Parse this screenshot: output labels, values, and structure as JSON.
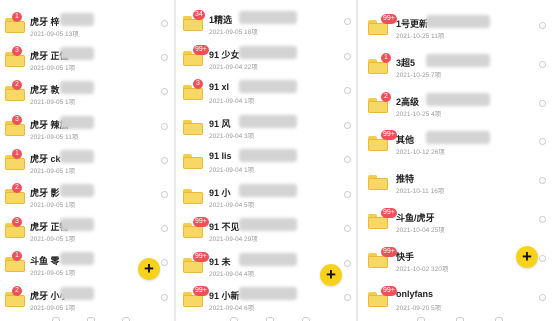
{
  "panel1": {
    "items": [
      {
        "badge": "1",
        "name": "虎牙 梓",
        "meta": "2021-09-05 13项",
        "blur": true
      },
      {
        "badge": "3",
        "name": "虎牙 正懂",
        "meta": "2021-09-05 1项",
        "blur": true
      },
      {
        "badge": "2",
        "name": "虎牙 敦",
        "meta": "2021-09-05 1项",
        "blur": true
      },
      {
        "badge": "3",
        "name": "虎牙 辣加",
        "meta": "2021-09-05 11项",
        "blur": true
      },
      {
        "badge": "1",
        "name": "虎牙 ck",
        "meta": "2021-09-05 1项",
        "blur": true
      },
      {
        "badge": "2",
        "name": "虎牙 影",
        "meta": "2021-09-05 1项",
        "blur": true
      },
      {
        "badge": "3",
        "name": "虎牙 正物",
        "meta": "2021-09-05 1项",
        "blur": true
      },
      {
        "badge": "1",
        "name": "斗鱼 零",
        "meta": "2021-09-05 1项",
        "blur": true
      },
      {
        "badge": "2",
        "name": "虎牙 小小",
        "meta": "2021-09-05 1项",
        "blur": true
      }
    ],
    "fab": "+"
  },
  "panel2": {
    "items": [
      {
        "badge": "34",
        "name": "1精选",
        "meta": "2021-09-05 18项",
        "blur": true
      },
      {
        "badge": "99+",
        "name": "91 少女",
        "meta": "2021-09-04 22项",
        "blur": true
      },
      {
        "badge": "3",
        "name": "91 xl",
        "meta": "2021-09-04 1项",
        "blur": true
      },
      {
        "badge": "",
        "name": "91 风",
        "meta": "2021-09-04 3项",
        "blur": true
      },
      {
        "badge": "",
        "name": "91 lis",
        "meta": "2021-09-04 1项",
        "blur": true
      },
      {
        "badge": "",
        "name": "91 小",
        "meta": "2021-09-04 5项",
        "blur": true
      },
      {
        "badge": "99+",
        "name": "91 不见",
        "meta": "2021-09-04 29项",
        "blur": true
      },
      {
        "badge": "99+",
        "name": "91 未",
        "meta": "2021-09-04 4项",
        "blur": true
      },
      {
        "badge": "99+",
        "name": "91 小新",
        "meta": "2021-09-04 6项",
        "blur": true
      }
    ],
    "fab": "+"
  },
  "panel3": {
    "items": [
      {
        "badge": "99+",
        "name": "1号更新",
        "meta": "2021-10-25 11项",
        "blur": true
      },
      {
        "badge": "1",
        "name": "3超5",
        "meta": "2021-10-25 7项",
        "blur": true
      },
      {
        "badge": "2",
        "name": "2高级",
        "meta": "2021-10-25 4项",
        "blur": true
      },
      {
        "badge": "99+",
        "name": "其他",
        "meta": "2021-10-12 26项",
        "blur": true
      },
      {
        "badge": "",
        "name": "推特",
        "meta": "2021-10-11 16项",
        "blur": false
      },
      {
        "badge": "99+",
        "name": "斗鱼/虎牙",
        "meta": "2021-10-04 25项",
        "blur": false
      },
      {
        "badge": "99+",
        "name": "快手",
        "meta": "2021-10-02 320项",
        "blur": false
      },
      {
        "badge": "99+",
        "name": "onlyfans",
        "meta": "2021-09-20 5项",
        "blur": false
      }
    ],
    "fab": "+"
  }
}
